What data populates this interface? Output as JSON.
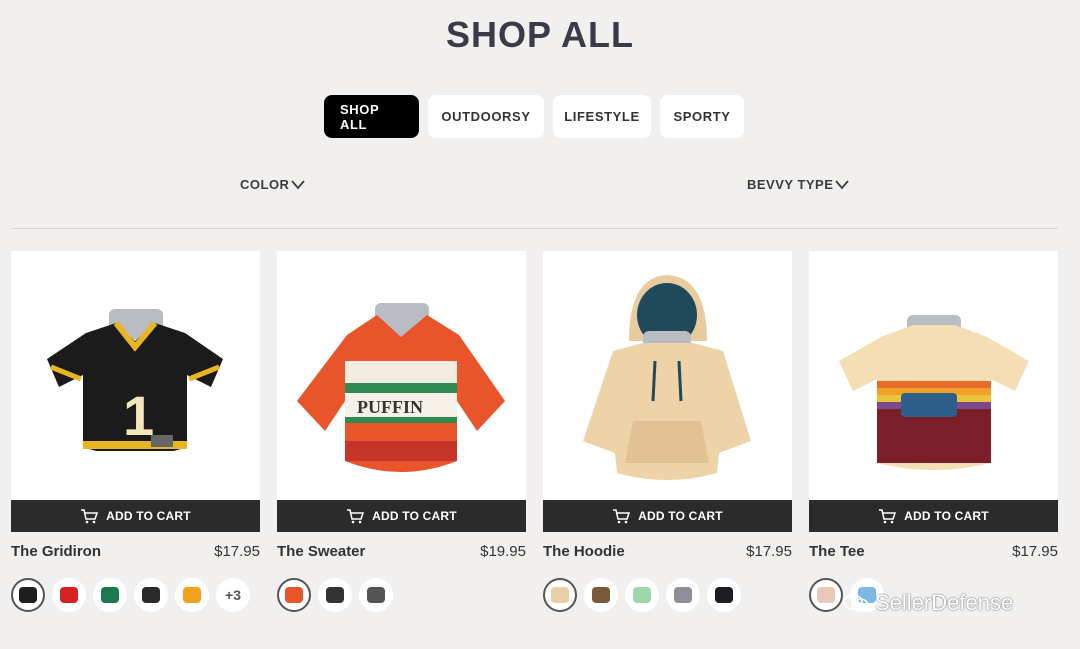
{
  "header": {
    "title": "SHOP ALL"
  },
  "tabs": [
    {
      "label": "SHOP ALL",
      "active": true
    },
    {
      "label": "OUTDOORSY",
      "active": false
    },
    {
      "label": "LIFESTYLE",
      "active": false
    },
    {
      "label": "SPORTY",
      "active": false
    }
  ],
  "filters": {
    "color": "COLOR",
    "bevvy_type": "BEVVY TYPE"
  },
  "cart_label": "ADD TO CART",
  "products": [
    {
      "name": "The Gridiron",
      "price": "$17.95",
      "swatches": [
        "#1e1e1e",
        "#d62121",
        "#1d7a4e",
        "#2a2a2a",
        "#f0a21e"
      ],
      "more": "+3"
    },
    {
      "name": "The Sweater",
      "price": "$19.95",
      "swatches": [
        "#e8552b",
        "#333333",
        "#555555"
      ],
      "more": ""
    },
    {
      "name": "The Hoodie",
      "price": "$17.95",
      "swatches": [
        "#e9cfa6",
        "#7a5a3a",
        "#9fd8a8",
        "#8e8e9a",
        "#1e1e22"
      ],
      "more": ""
    },
    {
      "name": "The Tee",
      "price": "$17.95",
      "swatches": [
        "#e8c8b8",
        "#7ab8e8"
      ],
      "more": ""
    }
  ],
  "watermark": "SellerDefense"
}
